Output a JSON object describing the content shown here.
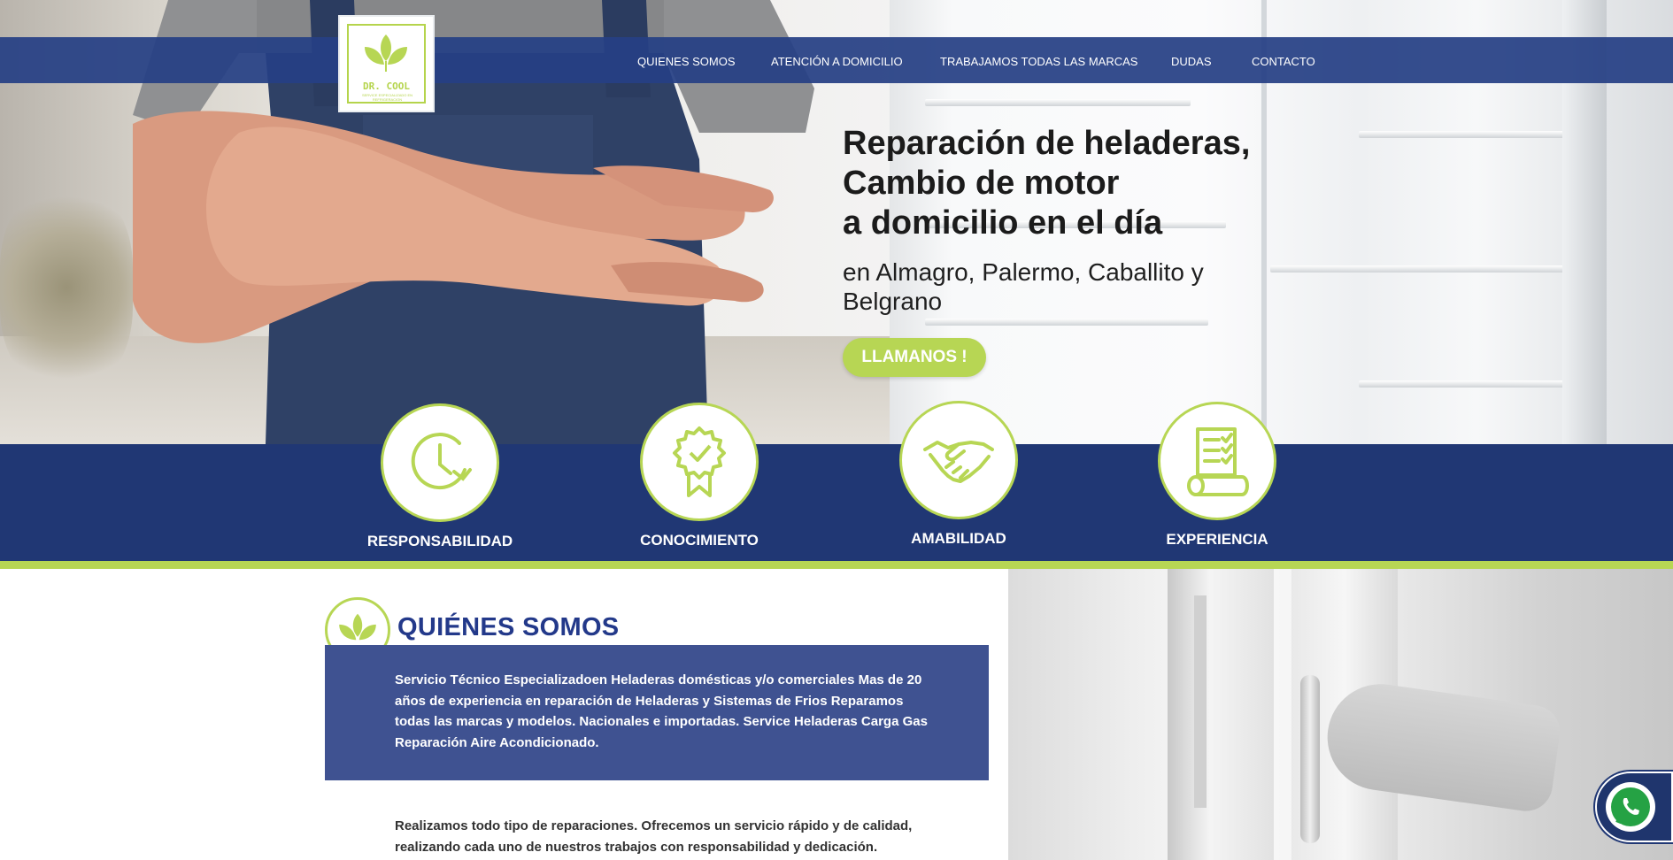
{
  "logo": {
    "name": "DR. COOL",
    "tagline": "SERVICE ESPECIALIZADO EN REFRIGERACION"
  },
  "nav": {
    "items": [
      {
        "label": "QUIENES SOMOS"
      },
      {
        "label": "ATENCIÓN A DOMICILIO"
      },
      {
        "label": "TRABAJAMOS TODAS LAS MARCAS"
      },
      {
        "label": "DUDAS"
      },
      {
        "label": "CONTACTO"
      }
    ]
  },
  "hero": {
    "title_line1": "Reparación de heladeras,",
    "title_line2": "Cambio de motor",
    "title_line3": "a domicilio en el día",
    "subtitle": "en Almagro, Palermo, Caballito y Belgrano",
    "cta_label": "LLAMANOS !"
  },
  "features": [
    {
      "label": "RESPONSABILIDAD",
      "icon": "clock-icon"
    },
    {
      "label": "CONOCIMIENTO",
      "icon": "award-icon"
    },
    {
      "label": "AMABILIDAD",
      "icon": "handshake-icon"
    },
    {
      "label": "EXPERIENCIA",
      "icon": "checklist-icon"
    }
  ],
  "about": {
    "title": "QUIÉNES SOMOS",
    "box_text": "Servicio Técnico Especializadoen Heladeras domésticas y/o comerciales Mas de 20 años de experiencia en reparación de Heladeras y Sistemas de Frios Reparamos todas las marcas y modelos. Nacionales e importadas. Service Heladeras Carga Gas Reparación Aire Acondicionado.",
    "paragraph": "Realizamos todo tipo de reparaciones. Ofrecemos un servicio rápido y de calidad, realizando cada uno de nuestros trabajos con responsabilidad y dedicación."
  },
  "colors": {
    "navy": "#203774",
    "lime": "#b7d654",
    "box": "#3f5291"
  },
  "whatsapp": {
    "icon": "whatsapp-icon"
  }
}
